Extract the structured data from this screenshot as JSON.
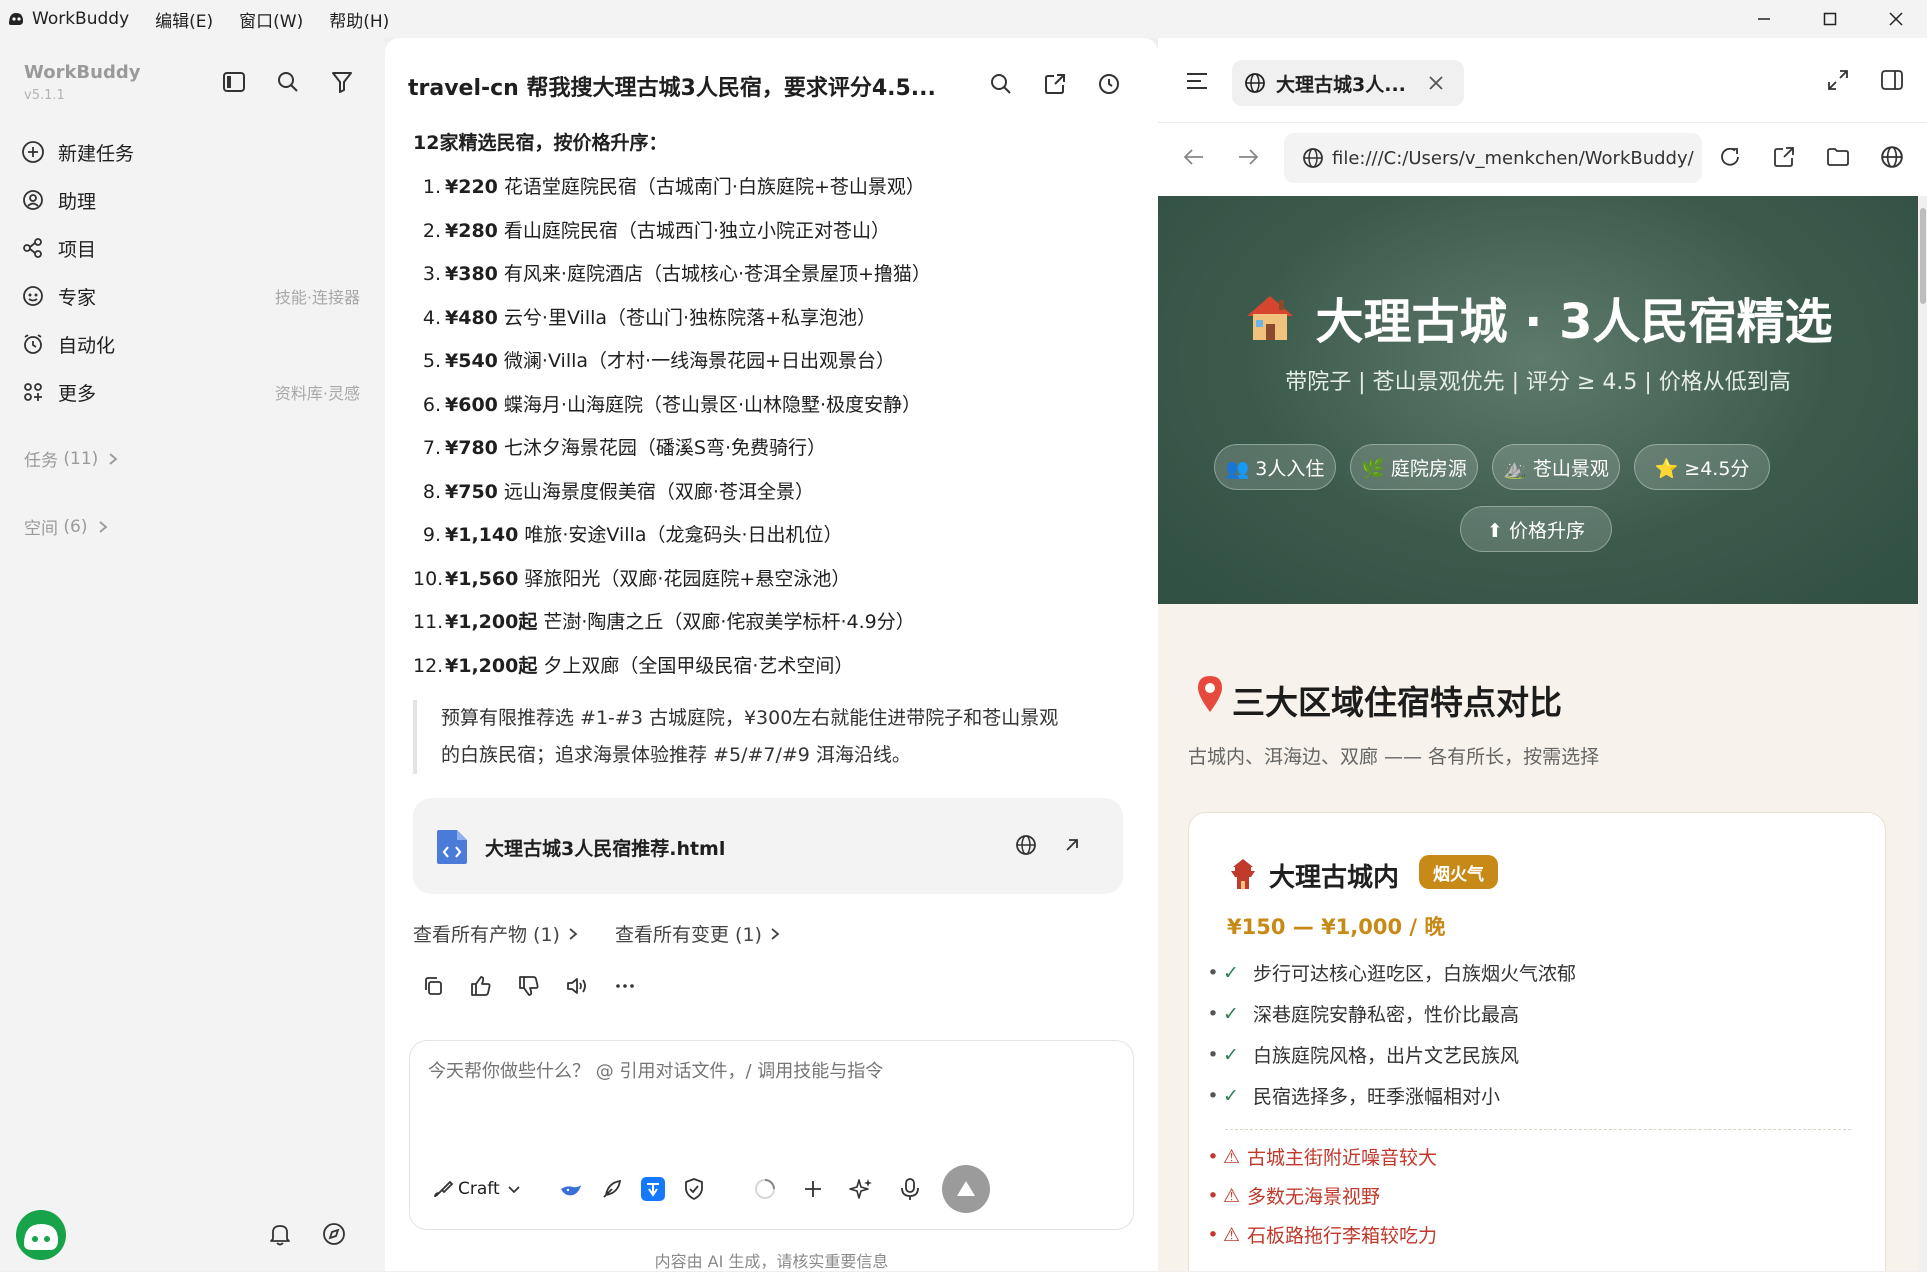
{
  "titlebar": {
    "app_name": "WorkBuddy",
    "menus": [
      "编辑(E)",
      "窗口(W)",
      "帮助(H)"
    ]
  },
  "sidebar": {
    "workspace": "WorkBuddy",
    "version": "v5.1.1",
    "nav": [
      {
        "label": "新建任务",
        "hint": "",
        "icon": "plus-circle-icon"
      },
      {
        "label": "助理",
        "hint": "",
        "icon": "assistant-icon"
      },
      {
        "label": "项目",
        "hint": "",
        "icon": "project-icon"
      },
      {
        "label": "专家",
        "hint": "技能·连接器",
        "icon": "expert-icon"
      },
      {
        "label": "自动化",
        "hint": "",
        "icon": "alarm-icon"
      },
      {
        "label": "更多",
        "hint": "资料库·灵感",
        "icon": "grid-plus-icon"
      }
    ],
    "sections": [
      {
        "label": "任务",
        "count": "(11)"
      },
      {
        "label": "空间",
        "count": "(6)"
      }
    ]
  },
  "chat": {
    "title": "travel-cn 帮我搜大理古城3人民宿，要求评分4.5...",
    "list_heading": "12家精选民宿，按价格升序：",
    "items": [
      {
        "num": "1.",
        "price": "¥220",
        "text": " 花语堂庭院民宿（古城南门·白族庭院+苍山景观）"
      },
      {
        "num": "2.",
        "price": "¥280",
        "text": " 看山庭院民宿（古城西门·独立小院正对苍山）"
      },
      {
        "num": "3.",
        "price": "¥380",
        "text": " 有风来·庭院酒店（古城核心·苍洱全景屋顶+撸猫）"
      },
      {
        "num": "4.",
        "price": "¥480",
        "text": " 云兮·里Villa（苍山门·独栋院落+私享泡池）"
      },
      {
        "num": "5.",
        "price": "¥540",
        "text": " 微澜·Villa（才村·一线海景花园+日出观景台）"
      },
      {
        "num": "6.",
        "price": "¥600",
        "text": " 蝶海月·山海庭院（苍山景区·山林隐墅·极度安静）"
      },
      {
        "num": "7.",
        "price": "¥780",
        "text": " 七沐夕海景花园（磻溪S弯·免费骑行）"
      },
      {
        "num": "8.",
        "price": "¥750",
        "text": " 远山海景度假美宿（双廊·苍洱全景）"
      },
      {
        "num": "9.",
        "price": "¥1,140",
        "text": " 唯旅·安途Villa（龙龛码头·日出机位）"
      },
      {
        "num": "10.",
        "price": "¥1,560",
        "text": " 驿旅阳光（双廊·花园庭院+悬空泳池）"
      },
      {
        "num": "11.",
        "price": "¥1,200起",
        "text": " 芒澍·陶唐之丘（双廊·侘寂美学标杆·4.9分）"
      },
      {
        "num": "12.",
        "price": "¥1,200起",
        "text": " 夕上双廊（全国甲级民宿·艺术空间）"
      }
    ],
    "quote_line1": "预算有限推荐选 #1-#3 古城庭院，¥300左右就能住进带院子和苍山景观",
    "quote_line2": "的白族民宿；追求海景体验推荐 #5/#7/#9 洱海沿线。",
    "file_name": "大理古城3人民宿推荐.html",
    "link_artifacts": "查看所有产物 (1)",
    "link_changes": "查看所有变更 (1)",
    "composer_placeholder": "今天帮你做些什么？ @ 引用对话文件，/ 调用技能与指令",
    "mode": "Craft",
    "disclaimer": "内容由 AI 生成，请核实重要信息"
  },
  "browser": {
    "tab_title": "大理古城3人...",
    "url": "file:///C:/Users/v_menkchen/WorkBuddy/"
  },
  "page": {
    "hero_title": "大理古城 · 3人民宿精选",
    "hero_subtitle": "带院子 | 苍山景观优先 | 评分 ≥ 4.5 | 价格从低到高",
    "pills": [
      "👥 3人入住",
      "🌿 庭院房源",
      "⛰️ 苍山景观",
      "⭐ ≥4.5分",
      "⬆ 价格升序"
    ],
    "section_title": "三大区域住宿特点对比",
    "section_subtitle": "古城内、洱海边、双廊 —— 各有所长，按需选择",
    "card_title": "大理古城内",
    "card_badge": "烟火气",
    "card_price": "¥150 — ¥1,000 / 晚",
    "pros": [
      "步行可达核心逛吃区，白族烟火气浓郁",
      "深巷庭院安静私密，性价比最高",
      "白族庭院风格，出片文艺民族风",
      "民宿选择多，旺季涨幅相对小"
    ],
    "cons": [
      "古城主街附近噪音较大",
      "多数无海景视野",
      "石板路拖行李箱较吃力"
    ]
  },
  "colors": {
    "accent_gold": "#c88a16",
    "hero_green": "#3c5a4c",
    "con_red": "#c0392b",
    "check_green": "#2f7d55"
  }
}
